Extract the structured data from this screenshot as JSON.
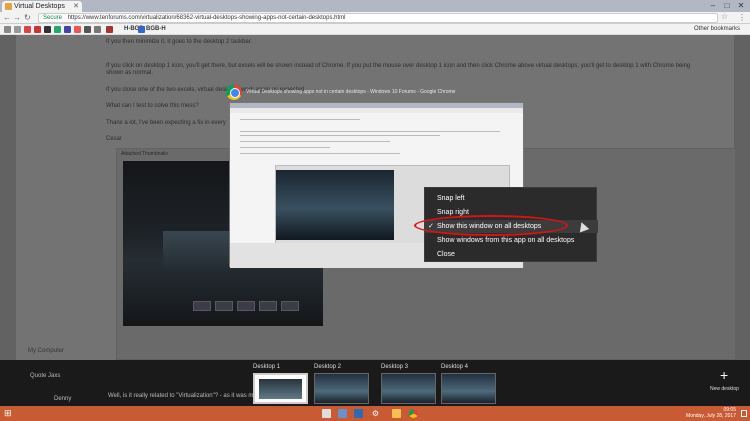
{
  "browser": {
    "tab_title": "Virtual Desktops",
    "secure_label": "Secure",
    "url": "https://www.tenforums.com/virtualization/68362-virtual-desktops-showing-apps-not-certain-desktops.html",
    "other_bookmarks": "Other bookmarks",
    "bookmarks": [
      "H-BGB",
      "BGB-H"
    ]
  },
  "page": {
    "line1": "If you then minimize it, it goes to the desktop 2 taskbar.",
    "line2": "If you click on desktop 1 icon, you'll get there, but excels will be shown instead of Chrome. If you put the mouse over desktop 1 icon and then click Chrome above virtual desktops, you'll get to desktop 1 with Chrome being",
    "line3": "shown as normal.",
    "line4": "If you close one of the two excels, virtual desktops work again as expected.",
    "line5": "What can I test to solve this mess?",
    "line6": "Thanx a lot, I've been expecting a fix in every",
    "line7": "Cesar",
    "attached_label": "Attached Thumbnails",
    "my_computer": "My Computer",
    "quote_label": "Quote Jaxs",
    "reply_snippet": "Well, is it really related to \"Virtualization\"? - as it was m",
    "poster": "Denny"
  },
  "task_view": {
    "window_title": "Virtual Desktops showing apps not in certain desktops - Windows 10 Forums - Google Chrome",
    "context_menu": {
      "items": [
        "Snap left",
        "Snap right",
        "Show this window on all desktops",
        "Show windows from this app on all desktops",
        "Close"
      ],
      "checked_index": 2
    },
    "desktops": [
      "Desktop 1",
      "Desktop 2",
      "Desktop 3",
      "Desktop 4"
    ],
    "active_desktop": 0,
    "new_desktop_label": "New desktop"
  },
  "taskbar": {
    "time": "09:05",
    "date": "Monday, July 28, 2017"
  },
  "colors": {
    "taskbar": "#c85a34",
    "highlight_ellipse": "#dd1111"
  }
}
